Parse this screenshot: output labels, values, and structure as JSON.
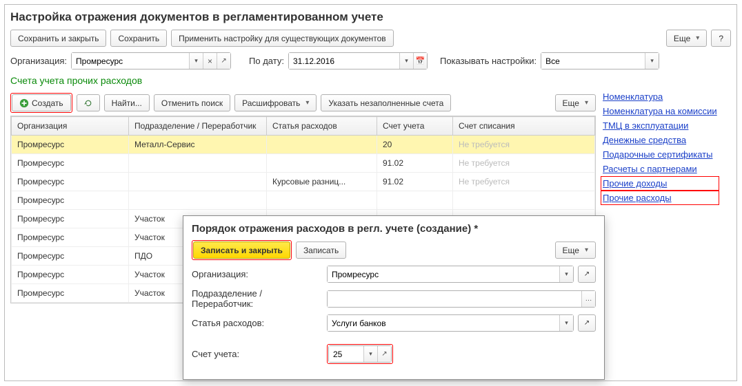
{
  "header": {
    "title": "Настройка отражения документов в регламентированном учете",
    "save_close": "Сохранить и закрыть",
    "save": "Сохранить",
    "apply": "Применить настройку для существующих документов",
    "more": "Еще",
    "help": "?"
  },
  "filters": {
    "org_label": "Организация:",
    "org_value": "Промресурс",
    "date_label": "По дату:",
    "date_value": "31.12.2016",
    "show_label": "Показывать настройки:",
    "show_value": "Все"
  },
  "section": {
    "title": "Счета учета прочих расходов",
    "create": "Создать",
    "find": "Найти...",
    "cancel_search": "Отменить поиск",
    "decode": "Расшифровать",
    "fill_blank": "Указать незаполненные счета",
    "more": "Еще"
  },
  "columns": {
    "org": "Организация",
    "dept": "Подразделение / Переработчик",
    "item": "Статья расходов",
    "acct": "Счет учета",
    "writeoff": "Счет списания"
  },
  "rows": [
    {
      "org": "Промресурс",
      "dept": "Металл-Сервис",
      "item": "",
      "acct": "20",
      "writeoff": "Не требуется",
      "sel": true
    },
    {
      "org": "Промресурс",
      "dept": "",
      "item": "",
      "acct": "91.02",
      "writeoff": "Не требуется"
    },
    {
      "org": "Промресурс",
      "dept": "",
      "item": "Курсовые разниц...",
      "acct": "91.02",
      "writeoff": "Не требуется"
    },
    {
      "org": "Промресурс",
      "dept": "",
      "item": "",
      "acct": "",
      "writeoff": ""
    },
    {
      "org": "Промресурс",
      "dept": "Участок",
      "item": "",
      "acct": "",
      "writeoff": ""
    },
    {
      "org": "Промресурс",
      "dept": "Участок",
      "item": "",
      "acct": "",
      "writeoff": ""
    },
    {
      "org": "Промресурс",
      "dept": "ПДО",
      "item": "",
      "acct": "",
      "writeoff": ""
    },
    {
      "org": "Промресурс",
      "dept": "Участок",
      "item": "",
      "acct": "",
      "writeoff": ""
    },
    {
      "org": "Промресурс",
      "dept": "Участок",
      "item": "",
      "acct": "",
      "writeoff": ""
    }
  ],
  "links": {
    "nomenclature": "Номенклатура",
    "nom_commission": "Номенклатура на комиссии",
    "tmc": "ТМЦ в эксплуатации",
    "cash": "Денежные средства",
    "gift": "Подарочные сертификаты",
    "partners": "Расчеты с партнерами",
    "other_income": "Прочие доходы",
    "other_expenses": "Прочие расходы"
  },
  "dialog": {
    "title": "Порядок отражения расходов в регл. учете (создание) *",
    "save_close": "Записать и закрыть",
    "save": "Записать",
    "more": "Еще",
    "org_label": "Организация:",
    "org_value": "Промресурс",
    "dept_label": "Подразделение / Переработчик:",
    "dept_value": "",
    "item_label": "Статья расходов:",
    "item_value": "Услуги банков",
    "acct_label": "Счет учета:",
    "acct_value": "25"
  }
}
